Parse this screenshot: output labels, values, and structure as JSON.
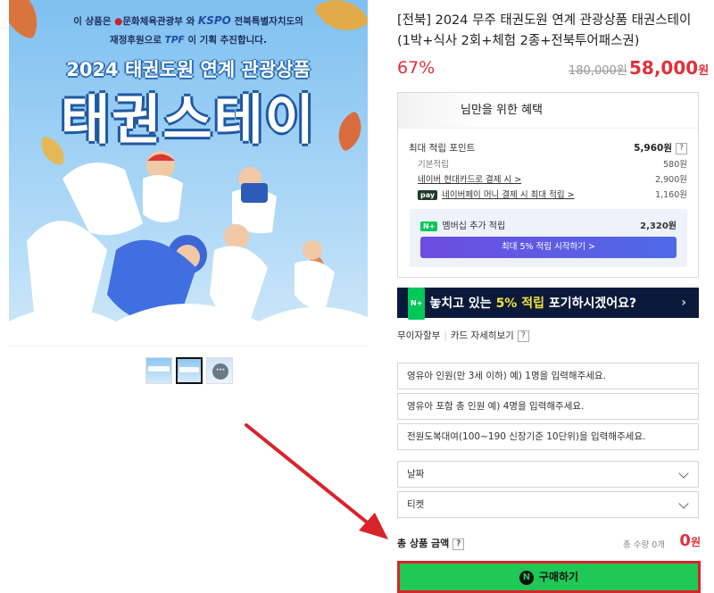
{
  "hero": {
    "sponsor_line1_a": "이 상품은",
    "sponsor_line1_b": "문화체육관광부",
    "sponsor_line1_c": "와",
    "sponsor_line1_d": "KSPO",
    "sponsor_line1_e": "전북특별자치도의",
    "sponsor_line2_a": "재정후원으로",
    "sponsor_line2_b": "TPF",
    "sponsor_line2_c": "이 기획 추진합니다.",
    "subtitle": "2024 태권도원 연계 관광상품",
    "headline": "태권스테이"
  },
  "thumbnails": {
    "more_label": "···"
  },
  "product": {
    "title": "[전북] 2024 무주 태권도원 연계 관광상품 태권스테이 (1박+식사 2회+체험 2종+전북투어패스권)",
    "discount": "67%",
    "original_price": "180,000원",
    "sale_price": "58,000",
    "sale_unit": "원"
  },
  "benefits": {
    "header": "님만을 위한 혜택",
    "max_points_label": "최대 적립 포인트",
    "max_points_value": "5,960원",
    "basic_label": "기본적립",
    "basic_value": "580원",
    "hyundai_label": "네이버 현대카드로 결제 시 >",
    "hyundai_value": "2,900원",
    "npay_label": "네이버페이 머니 결제 시 최대 적립 >",
    "npay_value": "1,160원",
    "membership_label": "멤버십 추가 적립",
    "membership_value": "2,320원",
    "membership_button": "최대 5% 적립 시작하기 >"
  },
  "promo": {
    "text_a": "놓치고 있는 ",
    "text_highlight": "5% 적립",
    "text_b": " 포기하시겠어요?",
    "chevron": "›"
  },
  "installment": {
    "label_a": "무이자할부",
    "label_b": "카드 자세히보기",
    "q": "?"
  },
  "fields": {
    "infant": "영유아 인원(만 3세 이하) 예) 1명을 입력해주세요.",
    "total_people": "영유아 포함 총 인원 예) 4명을 입력해주세요.",
    "uniform": "전원도복대여(100~190 신장기준 10단위)을 입력해주세요.",
    "date": "날짜",
    "ticket": "티켓"
  },
  "total": {
    "label": "총 상품 금액",
    "q": "?",
    "qty": "총 수량 0개",
    "price": "0",
    "unit": "원"
  },
  "buy": {
    "icon": "N",
    "label": "구매하기"
  },
  "colors": {
    "accent_red": "#e0313a",
    "naver_green": "#20c855",
    "promo_navy": "#0b1a3a",
    "highlight_yellow": "#f4e23b"
  }
}
